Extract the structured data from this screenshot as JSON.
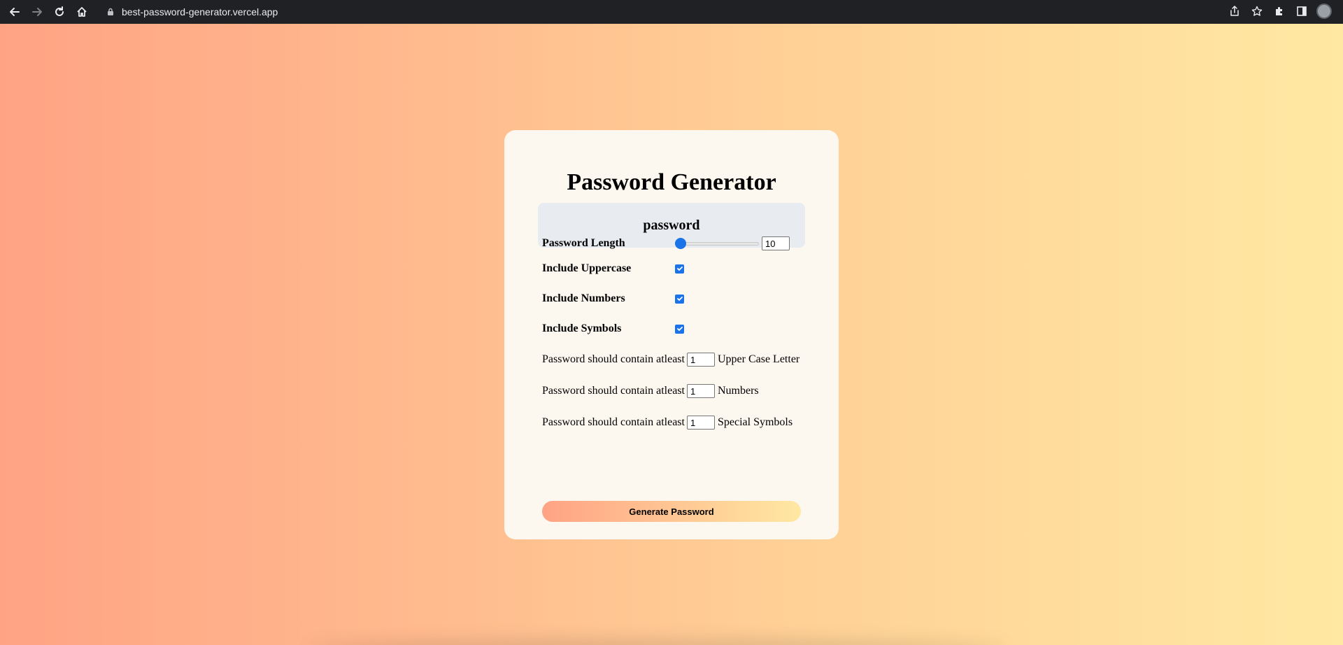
{
  "browser": {
    "url": "best-password-generator.vercel.app",
    "icons": [
      "back-icon",
      "forward-icon",
      "reload-icon",
      "home-icon",
      "lock-icon",
      "share-icon",
      "star-icon",
      "extensions-icon",
      "side-panel-icon",
      "avatar"
    ]
  },
  "app": {
    "title": "Password Generator",
    "generated_password": "password",
    "length": {
      "label": "Password Length",
      "value": "10",
      "slider_fraction": 0.0
    },
    "options": [
      {
        "label": "Include Uppercase",
        "checked": true
      },
      {
        "label": "Include Numbers",
        "checked": true
      },
      {
        "label": "Include Symbols",
        "checked": true
      }
    ],
    "minimums": [
      {
        "prefix": "Password should contain atleast",
        "value": "1",
        "suffix": "Upper Case Letter"
      },
      {
        "prefix": "Password should contain atleast",
        "value": "1",
        "suffix": "Numbers"
      },
      {
        "prefix": "Password should contain atleast",
        "value": "1",
        "suffix": "Special Symbols"
      }
    ],
    "generate_button": "Generate Password"
  },
  "colors": {
    "gradient_start": "#ffa384",
    "gradient_end": "#ffe8a2",
    "card_bg": "#fdf8ef",
    "display_bg": "#e8ecf0",
    "accent": "#1a73e8"
  }
}
